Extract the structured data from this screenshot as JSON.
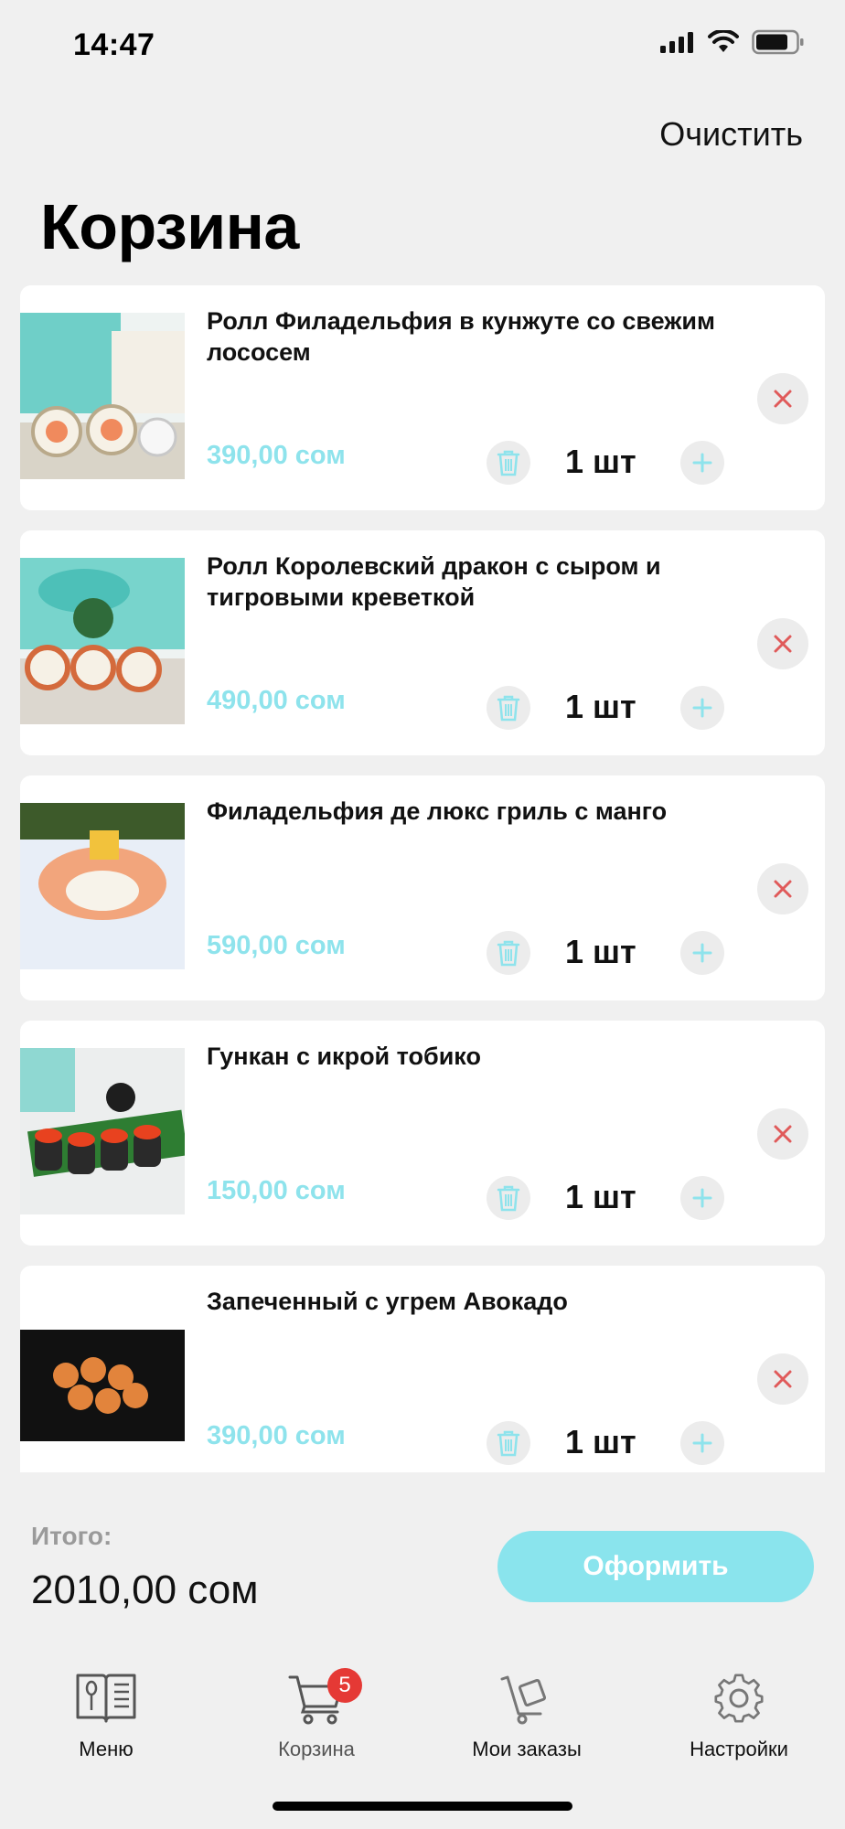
{
  "status_bar": {
    "time": "14:47"
  },
  "header": {
    "clear_label": "Очистить",
    "title": "Корзина"
  },
  "cart": {
    "items": [
      {
        "name": "Ролл Филадельфия в кунжуте со свежим лососем",
        "price": "390,00 сом",
        "qty": "1 шт"
      },
      {
        "name": "Ролл Королевский дракон с сыром и тигровыми креветкой",
        "price": "490,00 сом",
        "qty": "1 шт"
      },
      {
        "name": "Филадельфия де люкс гриль с манго",
        "price": "590,00 сом",
        "qty": "1 шт"
      },
      {
        "name": "Гункан с икрой тобико",
        "price": "150,00 сом",
        "qty": "1 шт"
      },
      {
        "name": "Запеченный с угрем Авокадо",
        "price": "390,00 сом",
        "qty": "1 шт"
      }
    ]
  },
  "summary": {
    "total_label": "Итого:",
    "total_value": "2010,00 сом",
    "checkout_label": "Оформить"
  },
  "tabbar": {
    "items": [
      {
        "label": "Меню",
        "icon": "menu-book-icon"
      },
      {
        "label": "Корзина",
        "icon": "cart-icon",
        "badge": "5"
      },
      {
        "label": "Мои заказы",
        "icon": "orders-cart-icon"
      },
      {
        "label": "Настройки",
        "icon": "gear-icon"
      }
    ]
  },
  "colors": {
    "accent": "#8ae4ed",
    "price": "#8ee3ec",
    "remove": "#e05a5a",
    "badge": "#e53935",
    "background": "#f0f0f0"
  }
}
